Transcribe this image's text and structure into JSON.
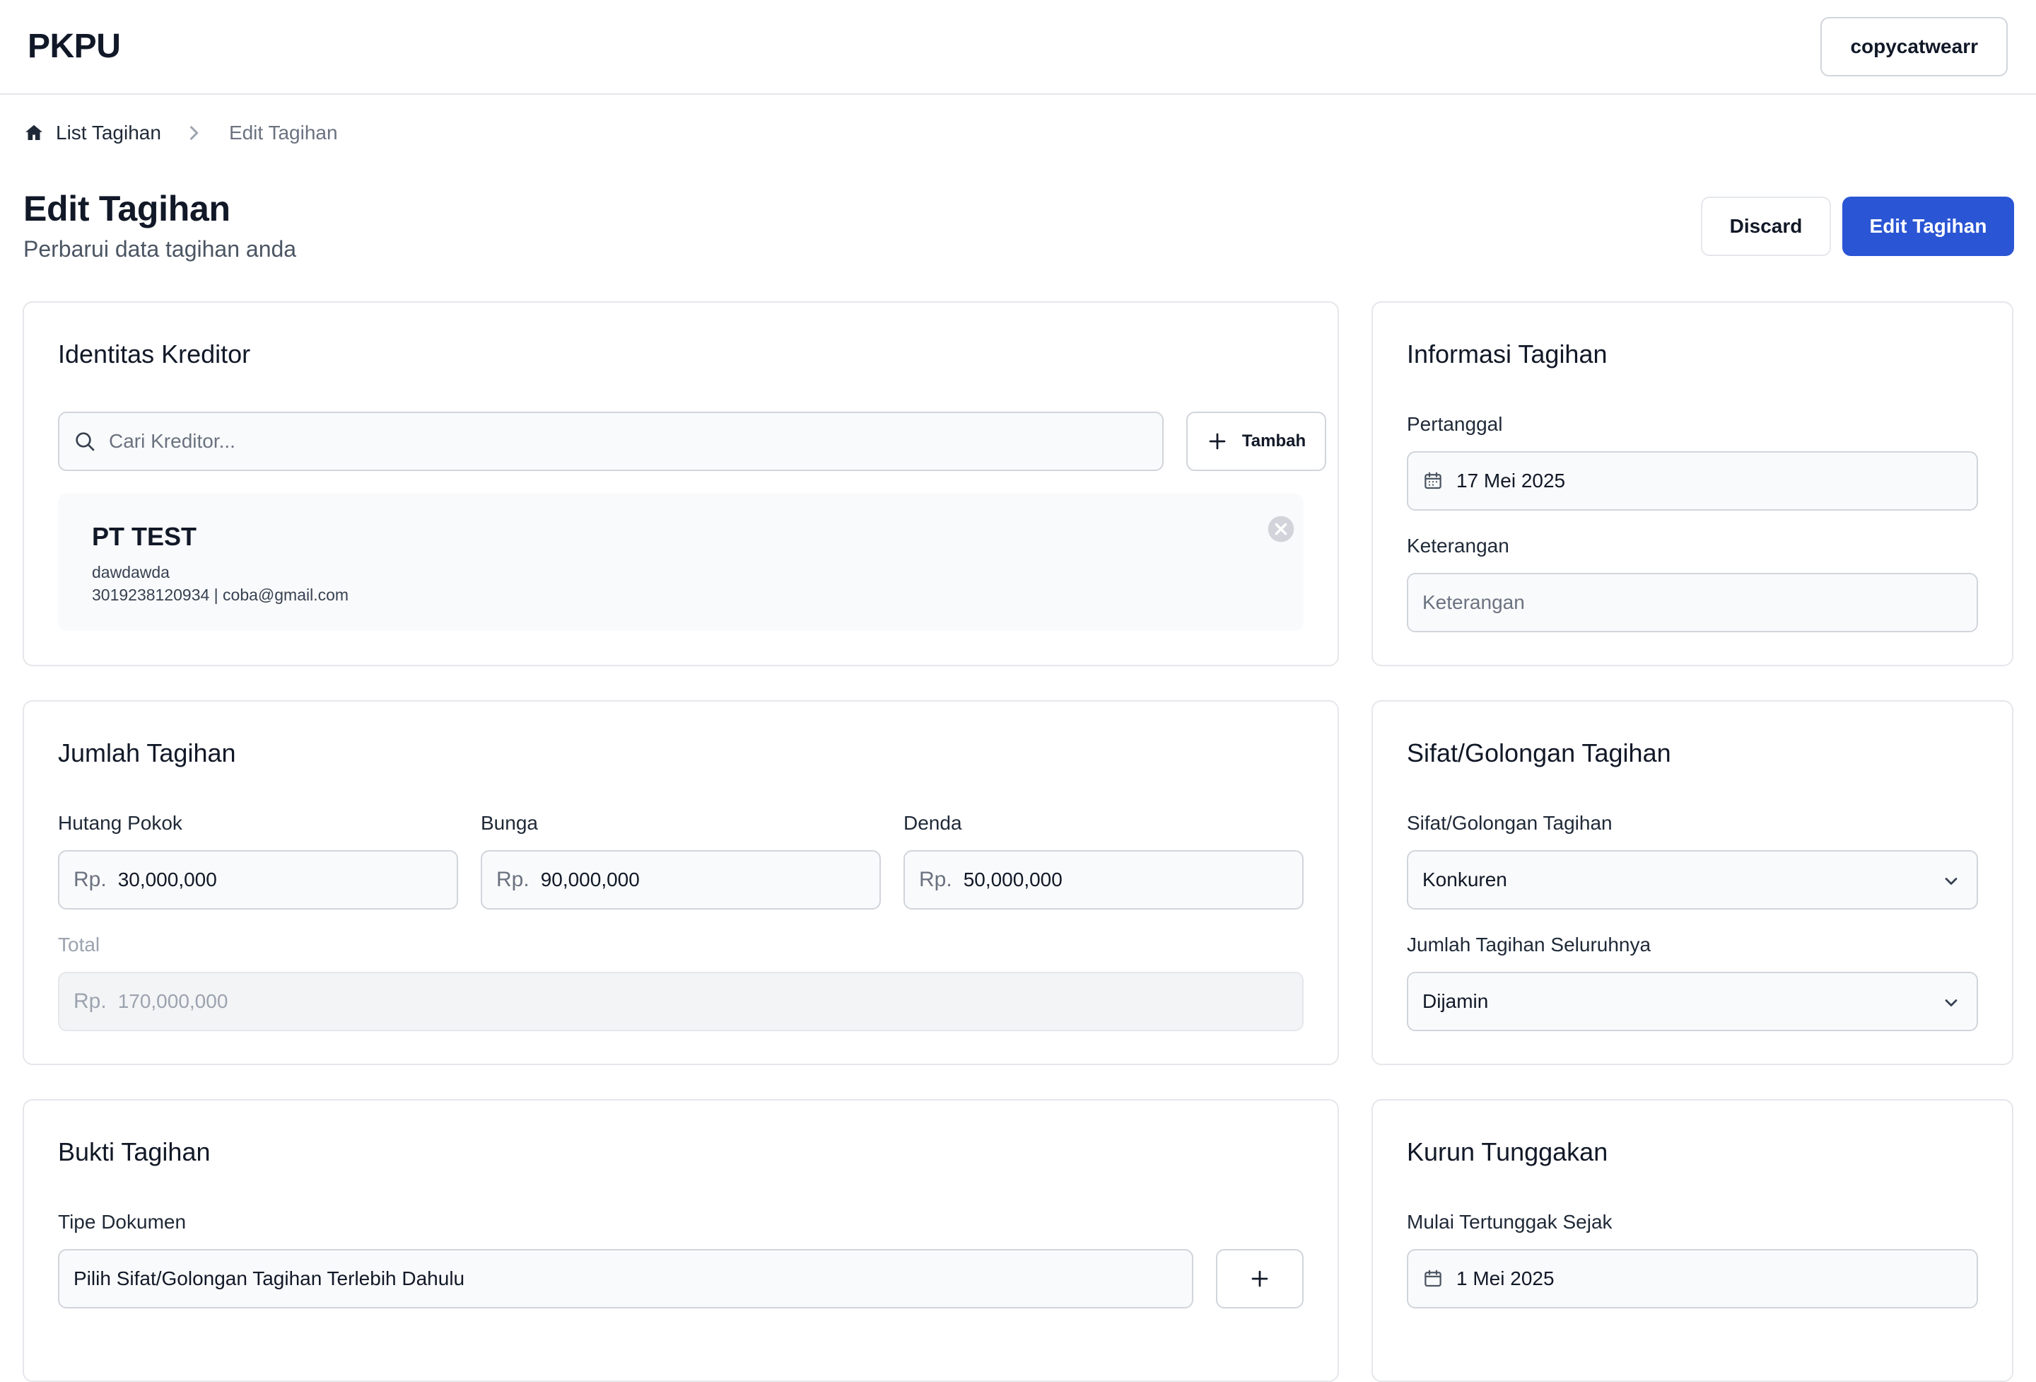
{
  "header": {
    "brand": "PKPU",
    "user": "copycatwearr"
  },
  "breadcrumb": {
    "home": "List Tagihan",
    "current": "Edit Tagihan"
  },
  "page": {
    "title": "Edit Tagihan",
    "subtitle": "Perbarui data tagihan anda",
    "discard_label": "Discard",
    "submit_label": "Edit Tagihan"
  },
  "identitas": {
    "title": "Identitas Kreditor",
    "search_placeholder": "Cari Kreditor...",
    "add_label": "Tambah",
    "selected": {
      "name": "PT TEST",
      "line1": "dawdawda",
      "line2": "3019238120934 | coba@gmail.com"
    }
  },
  "informasi": {
    "title": "Informasi Tagihan",
    "date_label": "Pertanggal",
    "date_value": "17 Mei 2025",
    "note_label": "Keterangan",
    "note_placeholder": "Keterangan"
  },
  "jumlah": {
    "title": "Jumlah Tagihan",
    "currency": "Rp.",
    "fields": [
      {
        "label": "Hutang Pokok",
        "value": "30,000,000"
      },
      {
        "label": "Bunga",
        "value": "90,000,000"
      },
      {
        "label": "Denda",
        "value": "50,000,000"
      }
    ],
    "total_label": "Total",
    "total_value": "170,000,000"
  },
  "sifat": {
    "title": "Sifat/Golongan Tagihan",
    "type_label": "Sifat/Golongan Tagihan",
    "type_value": "Konkuren",
    "all_label": "Jumlah Tagihan Seluruhnya",
    "all_value": "Dijamin"
  },
  "bukti": {
    "title": "Bukti Tagihan",
    "doc_label": "Tipe Dokumen",
    "doc_placeholder": "Pilih Sifat/Golongan Tagihan Terlebih Dahulu"
  },
  "kurun": {
    "title": "Kurun Tunggakan",
    "since_label": "Mulai Tertunggak Sejak",
    "since_value": "1 Mei 2025"
  }
}
